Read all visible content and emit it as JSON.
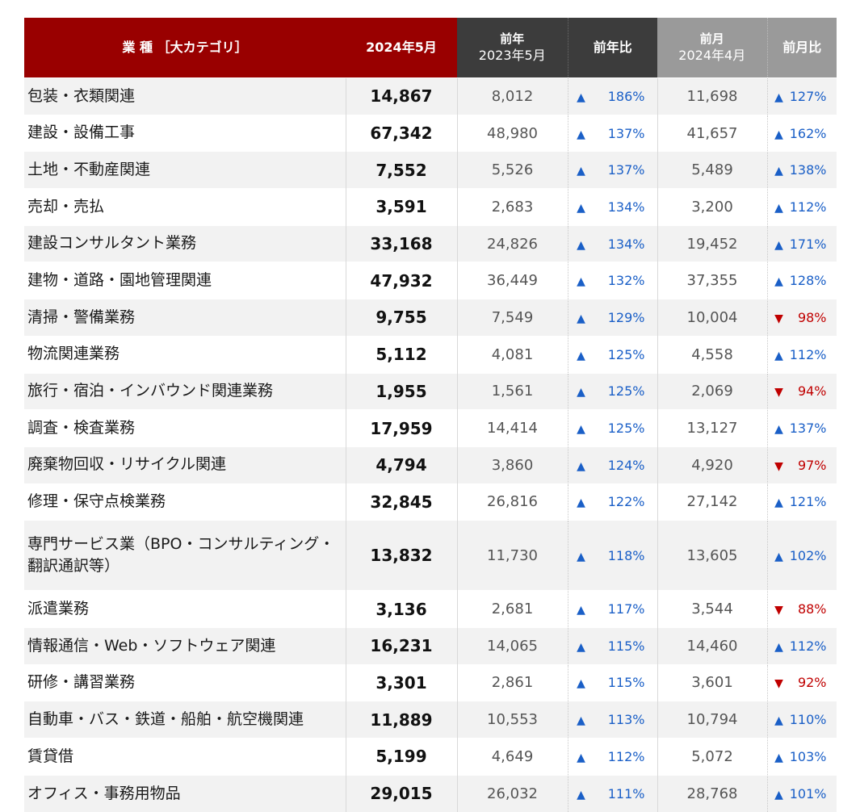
{
  "header": {
    "category": "業 種 ［大カテゴリ］",
    "current": "2024年5月",
    "prev_year_top": "前年",
    "prev_year_sub": "2023年5月",
    "yoy": "前年比",
    "prev_month_top": "前月",
    "prev_month_sub": "2024年4月",
    "mom": "前月比"
  },
  "colors": {
    "header_red": "#990000",
    "header_dark": "#3c3c3c",
    "header_gray": "#9a9a9a",
    "up": "#1a5fc7",
    "down": "#c00000"
  },
  "icons": {
    "up": "▲",
    "down": "▼"
  },
  "rows": [
    {
      "category": "包装・衣類関連",
      "current": "14,867",
      "prev_year": "8,012",
      "yoy": "186%",
      "yoy_dir": "up",
      "prev_month": "11,698",
      "mom": "127%",
      "mom_dir": "up"
    },
    {
      "category": "建設・設備工事",
      "current": "67,342",
      "prev_year": "48,980",
      "yoy": "137%",
      "yoy_dir": "up",
      "prev_month": "41,657",
      "mom": "162%",
      "mom_dir": "up"
    },
    {
      "category": "土地・不動産関連",
      "current": "7,552",
      "prev_year": "5,526",
      "yoy": "137%",
      "yoy_dir": "up",
      "prev_month": "5,489",
      "mom": "138%",
      "mom_dir": "up"
    },
    {
      "category": "売却・売払",
      "current": "3,591",
      "prev_year": "2,683",
      "yoy": "134%",
      "yoy_dir": "up",
      "prev_month": "3,200",
      "mom": "112%",
      "mom_dir": "up"
    },
    {
      "category": "建設コンサルタント業務",
      "current": "33,168",
      "prev_year": "24,826",
      "yoy": "134%",
      "yoy_dir": "up",
      "prev_month": "19,452",
      "mom": "171%",
      "mom_dir": "up"
    },
    {
      "category": "建物・道路・園地管理関連",
      "current": "47,932",
      "prev_year": "36,449",
      "yoy": "132%",
      "yoy_dir": "up",
      "prev_month": "37,355",
      "mom": "128%",
      "mom_dir": "up"
    },
    {
      "category": "清掃・警備業務",
      "current": "9,755",
      "prev_year": "7,549",
      "yoy": "129%",
      "yoy_dir": "up",
      "prev_month": "10,004",
      "mom": "98%",
      "mom_dir": "down"
    },
    {
      "category": "物流関連業務",
      "current": "5,112",
      "prev_year": "4,081",
      "yoy": "125%",
      "yoy_dir": "up",
      "prev_month": "4,558",
      "mom": "112%",
      "mom_dir": "up"
    },
    {
      "category": "旅行・宿泊・インバウンド関連業務",
      "current": "1,955",
      "prev_year": "1,561",
      "yoy": "125%",
      "yoy_dir": "up",
      "prev_month": "2,069",
      "mom": "94%",
      "mom_dir": "down"
    },
    {
      "category": "調査・検査業務",
      "current": "17,959",
      "prev_year": "14,414",
      "yoy": "125%",
      "yoy_dir": "up",
      "prev_month": "13,127",
      "mom": "137%",
      "mom_dir": "up"
    },
    {
      "category": "廃棄物回収・リサイクル関連",
      "current": "4,794",
      "prev_year": "3,860",
      "yoy": "124%",
      "yoy_dir": "up",
      "prev_month": "4,920",
      "mom": "97%",
      "mom_dir": "down"
    },
    {
      "category": "修理・保守点検業務",
      "current": "32,845",
      "prev_year": "26,816",
      "yoy": "122%",
      "yoy_dir": "up",
      "prev_month": "27,142",
      "mom": "121%",
      "mom_dir": "up"
    },
    {
      "category": "専門サービス業（BPO・コンサルティング・翻訳通訳等）",
      "current": "13,832",
      "prev_year": "11,730",
      "yoy": "118%",
      "yoy_dir": "up",
      "prev_month": "13,605",
      "mom": "102%",
      "mom_dir": "up"
    },
    {
      "category": "派遣業務",
      "current": "3,136",
      "prev_year": "2,681",
      "yoy": "117%",
      "yoy_dir": "up",
      "prev_month": "3,544",
      "mom": "88%",
      "mom_dir": "down"
    },
    {
      "category": "情報通信・Web・ソフトウェア関連",
      "current": "16,231",
      "prev_year": "14,065",
      "yoy": "115%",
      "yoy_dir": "up",
      "prev_month": "14,460",
      "mom": "112%",
      "mom_dir": "up"
    },
    {
      "category": "研修・講習業務",
      "current": "3,301",
      "prev_year": "2,861",
      "yoy": "115%",
      "yoy_dir": "up",
      "prev_month": "3,601",
      "mom": "92%",
      "mom_dir": "down"
    },
    {
      "category": "自動車・バス・鉄道・船舶・航空機関連",
      "current": "11,889",
      "prev_year": "10,553",
      "yoy": "113%",
      "yoy_dir": "up",
      "prev_month": "10,794",
      "mom": "110%",
      "mom_dir": "up"
    },
    {
      "category": "賃貸借",
      "current": "5,199",
      "prev_year": "4,649",
      "yoy": "112%",
      "yoy_dir": "up",
      "prev_month": "5,072",
      "mom": "103%",
      "mom_dir": "up"
    },
    {
      "category": "オフィス・事務用物品",
      "current": "29,015",
      "prev_year": "26,032",
      "yoy": "111%",
      "yoy_dir": "up",
      "prev_month": "28,768",
      "mom": "101%",
      "mom_dir": "up"
    }
  ]
}
